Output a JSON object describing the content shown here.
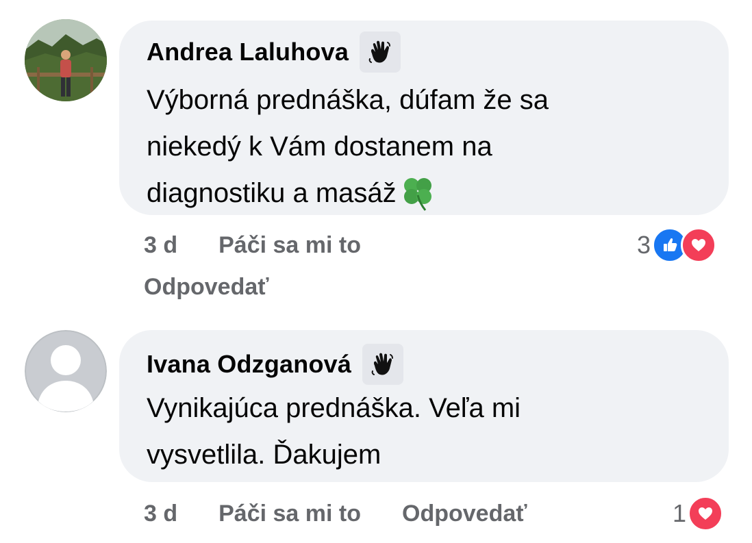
{
  "comments": [
    {
      "author": "Andrea Laluhova",
      "badge_icon": "waving-hand-icon",
      "text_lines": [
        "Výborná prednáška, dúfam že sa",
        "niekedý k Vám dostanem na",
        "diagnostiku a masáž"
      ],
      "text_emoji": "🍀",
      "time": "3 d",
      "like_label": "Páči sa mi to",
      "reply_label": "Odpovedať",
      "reaction_count": "3",
      "reactions": [
        "like",
        "love"
      ]
    },
    {
      "author": "Ivana Odzganová",
      "badge_icon": "waving-hand-icon",
      "text_lines": [
        "Vynikajúca prednáška. Veľa mi",
        "vysvetlila. Ďakujem"
      ],
      "time": "3 d",
      "like_label": "Páči sa mi to",
      "reply_label": "Odpovedať",
      "reaction_count": "1",
      "reactions": [
        "love"
      ]
    }
  ],
  "colors": {
    "bubble": "#f0f2f5",
    "meta_text": "#65676b",
    "like": "#1877f2",
    "love": "#f33e58"
  }
}
